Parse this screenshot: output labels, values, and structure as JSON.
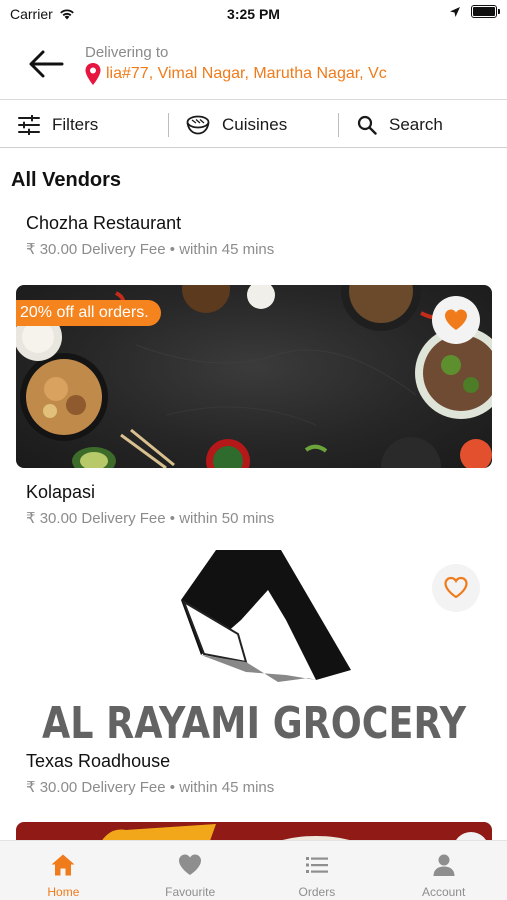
{
  "status_bar": {
    "carrier": "Carrier",
    "time": "3:25 PM"
  },
  "header": {
    "delivering_label": "Delivering to",
    "address": "lia#77, Vimal Nagar, Marutha Nagar, Vc"
  },
  "filter_bar": {
    "filters_label": "Filters",
    "cuisines_label": "Cuisines",
    "search_label": "Search"
  },
  "section_title": "All Vendors",
  "vendors": [
    {
      "name": "Chozha Restaurant",
      "delivery_fee": "₹ 30.00 Delivery Fee",
      "separator": "•",
      "eta": "within 45 mins"
    },
    {
      "name": "Kolapasi",
      "delivery_fee": "₹ 30.00 Delivery Fee",
      "separator": "•",
      "eta": "within 50 mins",
      "promo": "20% off all orders.",
      "favorite": true
    },
    {
      "name": "Texas Roadhouse",
      "delivery_fee": "₹ 30.00 Delivery Fee",
      "separator": "•",
      "eta": "within 45 mins",
      "favorite": false,
      "logo_text": "AL RAYAMI GROCERY"
    }
  ],
  "tabs": [
    {
      "label": "Home",
      "icon": "home-icon",
      "active": true
    },
    {
      "label": "Favourite",
      "icon": "heart-icon",
      "active": false
    },
    {
      "label": "Orders",
      "icon": "list-icon",
      "active": false
    },
    {
      "label": "Account",
      "icon": "person-icon",
      "active": false
    }
  ],
  "colors": {
    "accent": "#f07b1b",
    "promo_bg": "#f5841f",
    "pin": "#e5173f",
    "muted": "#8c8c8c",
    "tab_inactive": "#8e8e8e"
  }
}
